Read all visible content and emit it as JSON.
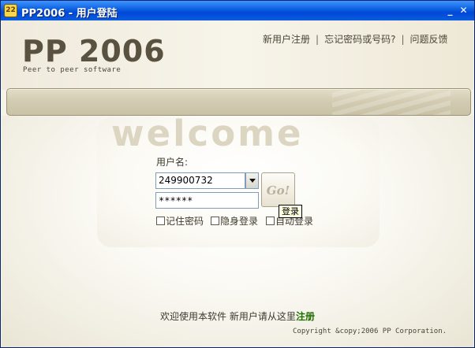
{
  "window": {
    "title": "PP2006 - 用户登陆",
    "icon_text": "22",
    "minimize_glyph": "_",
    "close_glyph": "✕"
  },
  "header": {
    "logo": "PP 2006",
    "tagline": "Peer to peer software",
    "links": {
      "register": "新用户注册",
      "forgot": "忘记密码或号码?",
      "feedback": "问题反馈",
      "separator": "|"
    }
  },
  "welcome": "welcome",
  "login": {
    "username_label": "用户名:",
    "username_value": "249900732",
    "password_value": "******",
    "go_label": "Go!",
    "tooltip": "登录",
    "options": {
      "remember": "记住密码",
      "hidden": "隐身登录",
      "auto": "自动登录"
    }
  },
  "footer": {
    "welcome_text": "欢迎使用本软件 新用户请从这里",
    "register_link": "注册",
    "copyright": "Copyright &copy;2006 PP Corporation."
  },
  "colors": {
    "titlebar": "#0a5ddf",
    "background": "#f5f2e6",
    "register_link": "#1f6e00"
  }
}
